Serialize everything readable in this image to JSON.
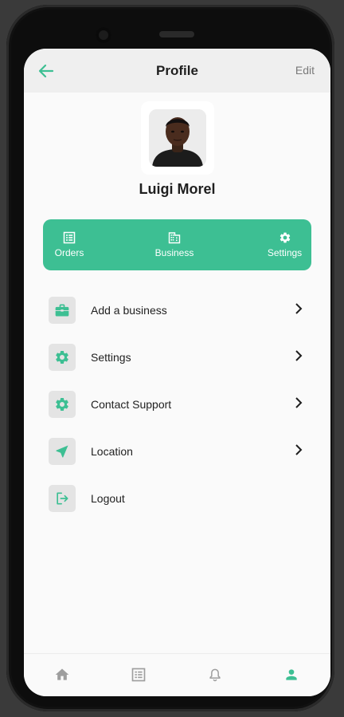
{
  "colors": {
    "accent": "#3dbf93",
    "icon_box": "#e4e4e4",
    "nav_inactive": "#9e9e9e"
  },
  "header": {
    "title": "Profile",
    "edit_label": "Edit",
    "back_icon": "arrow-left-icon"
  },
  "profile": {
    "name": "Luigi Morel"
  },
  "quick_actions": [
    {
      "icon": "list-icon",
      "label": "Orders"
    },
    {
      "icon": "building-icon",
      "label": "Business"
    },
    {
      "icon": "gear-icon",
      "label": "Settings"
    }
  ],
  "menu": [
    {
      "icon": "briefcase-icon",
      "label": "Add a business",
      "has_chevron": true
    },
    {
      "icon": "gear-icon",
      "label": "Settings",
      "has_chevron": true
    },
    {
      "icon": "gear-icon",
      "label": "Contact Support",
      "has_chevron": true
    },
    {
      "icon": "navigation-arrow-icon",
      "label": "Location",
      "has_chevron": true
    },
    {
      "icon": "logout-icon",
      "label": "Logout",
      "has_chevron": false
    }
  ],
  "bottom_nav": [
    {
      "icon": "home-icon",
      "active": false
    },
    {
      "icon": "list-icon",
      "active": false
    },
    {
      "icon": "bell-icon",
      "active": false
    },
    {
      "icon": "person-icon",
      "active": true
    }
  ]
}
